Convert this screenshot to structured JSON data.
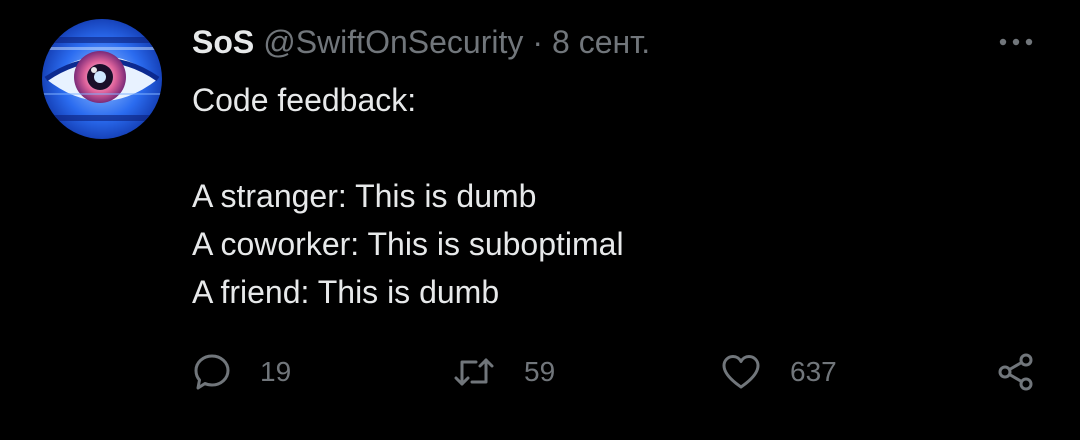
{
  "tweet": {
    "display_name": "SoS",
    "handle": "@SwiftOnSecurity",
    "separator": "·",
    "date": "8 сент.",
    "lines": [
      "Code feedback:",
      "",
      "A stranger: This is dumb",
      "A coworker: This is suboptimal",
      "A friend: This is dumb"
    ],
    "reply_count": "19",
    "retweet_count": "59",
    "like_count": "637"
  },
  "icons": {
    "more": "more-horizontal-icon",
    "reply": "speech-bubble-icon",
    "retweet": "retweet-arrows-icon",
    "like": "heart-icon",
    "share": "share-nodes-icon"
  },
  "colors": {
    "background": "#000000",
    "primary_text": "#e7e9ea",
    "secondary_text": "#71767b",
    "avatar_blue": "#1f5fd6"
  }
}
